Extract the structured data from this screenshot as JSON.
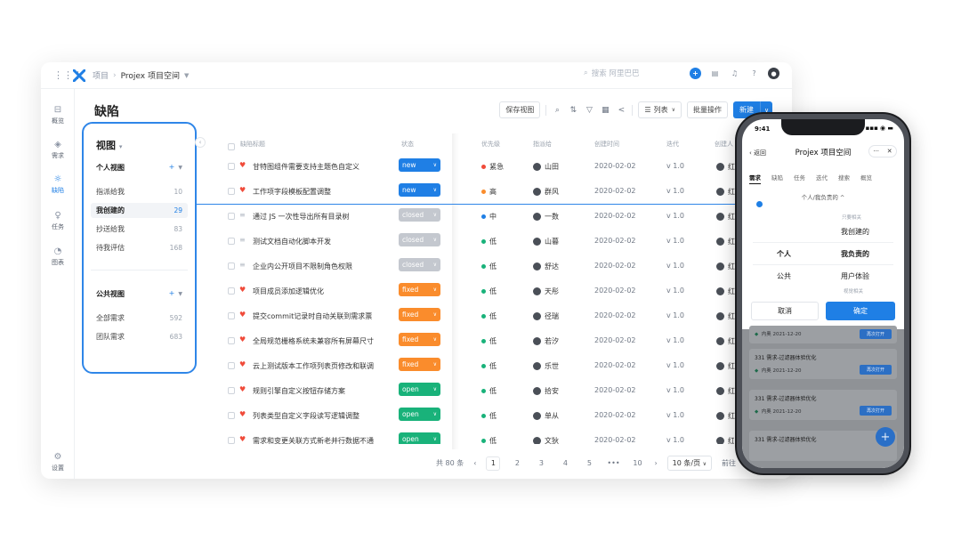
{
  "topbar": {
    "breadcrumb_root": "项目",
    "breadcrumb_sep": "›",
    "breadcrumb_current": "Projex 项目空间",
    "search_placeholder": "搜索 阿里巴巴"
  },
  "leftnav": {
    "items": [
      {
        "label": "概览",
        "icon": "overview-icon"
      },
      {
        "label": "需求",
        "icon": "layers-icon"
      },
      {
        "label": "缺陷",
        "icon": "bug-icon"
      },
      {
        "label": "任务",
        "icon": "bulb-icon"
      },
      {
        "label": "图表",
        "icon": "chart-icon"
      }
    ],
    "settings": "设置"
  },
  "page": {
    "title": "缺陷"
  },
  "toolbar": {
    "save_view": "保存视图",
    "list_view": "列表",
    "batch": "批量操作",
    "create": "新建"
  },
  "views": {
    "title": "视图",
    "personal_title": "个人视图",
    "personal": [
      {
        "label": "指派给我",
        "count": "10"
      },
      {
        "label": "我创建的",
        "count": "29"
      },
      {
        "label": "抄送给我",
        "count": "83"
      },
      {
        "label": "待我评估",
        "count": "168"
      }
    ],
    "public_title": "公共视图",
    "public": [
      {
        "label": "全部需求",
        "count": "592"
      },
      {
        "label": "团队需求",
        "count": "683"
      }
    ]
  },
  "table": {
    "headers": [
      "缺陷标题",
      "状态",
      "优先级",
      "指派给",
      "创建时间",
      "迭代",
      "创建人"
    ],
    "rows": [
      {
        "title": "甘特图组件需要支持主题色自定义",
        "type": "bug",
        "status": "new",
        "priority": "紧急",
        "prio_color": "#f04b3a",
        "assignee": "山田",
        "date": "2020-02-02",
        "iter": "v 1.0",
        "creator": "红"
      },
      {
        "title": "工作项字段模板配置调整",
        "type": "bug",
        "status": "new",
        "priority": "高",
        "prio_color": "#fa8c2c",
        "assignee": "群风",
        "date": "2020-02-02",
        "iter": "v 1.0",
        "creator": "红"
      },
      {
        "title": "通过 JS 一次性导出所有目录树",
        "type": "doc",
        "status": "closed",
        "priority": "中",
        "prio_color": "#1f7fe5",
        "assignee": "一数",
        "date": "2020-02-02",
        "iter": "v 1.0",
        "creator": "红"
      },
      {
        "title": "测试文档自动化脚本开发",
        "type": "doc",
        "status": "closed",
        "priority": "低",
        "prio_color": "#19b27a",
        "assignee": "山暮",
        "date": "2020-02-02",
        "iter": "v 1.0",
        "creator": "红"
      },
      {
        "title": "企业内公开项目不限制角色权限",
        "type": "doc",
        "status": "closed",
        "priority": "低",
        "prio_color": "#19b27a",
        "assignee": "舒达",
        "date": "2020-02-02",
        "iter": "v 1.0",
        "creator": "红"
      },
      {
        "title": "项目成员添加逻辑优化",
        "type": "bug",
        "status": "fixed",
        "priority": "低",
        "prio_color": "#19b27a",
        "assignee": "天彤",
        "date": "2020-02-02",
        "iter": "v 1.0",
        "creator": "红"
      },
      {
        "title": "提交commit记录时自动关联到需求票",
        "type": "bug",
        "status": "fixed",
        "priority": "低",
        "prio_color": "#19b27a",
        "assignee": "径瑞",
        "date": "2020-02-02",
        "iter": "v 1.0",
        "creator": "红"
      },
      {
        "title": "全局规范栅格系统未兼容所有屏幕尺寸",
        "type": "bug",
        "status": "fixed",
        "priority": "低",
        "prio_color": "#19b27a",
        "assignee": "若汐",
        "date": "2020-02-02",
        "iter": "v 1.0",
        "creator": "红"
      },
      {
        "title": "云上测试版本工作项列表页修改和联调",
        "type": "bug",
        "status": "fixed",
        "priority": "低",
        "prio_color": "#19b27a",
        "assignee": "乐世",
        "date": "2020-02-02",
        "iter": "v 1.0",
        "creator": "红"
      },
      {
        "title": "规则引擎自定义按钮存储方案",
        "type": "bug",
        "status": "open",
        "priority": "低",
        "prio_color": "#19b27a",
        "assignee": "拾安",
        "date": "2020-02-02",
        "iter": "v 1.0",
        "creator": "红"
      },
      {
        "title": "列表类型自定义字段读写逻辑调整",
        "type": "bug",
        "status": "open",
        "priority": "低",
        "prio_color": "#19b27a",
        "assignee": "单从",
        "date": "2020-02-02",
        "iter": "v 1.0",
        "creator": "红"
      },
      {
        "title": "需求和变更关联方式新老并行数据不通",
        "type": "bug",
        "status": "open",
        "priority": "低",
        "prio_color": "#19b27a",
        "assignee": "文狄",
        "date": "2020-02-02",
        "iter": "v 1.0",
        "creator": "红"
      }
    ]
  },
  "pager": {
    "total": "共 80 条",
    "pages": [
      "1",
      "2",
      "3",
      "4",
      "5",
      "•••",
      "10"
    ],
    "size": "10 条/页",
    "goto": "前往"
  },
  "phone": {
    "time": "9:41",
    "status": "▪▪▪ ◉ ▬",
    "back": "‹ 返回",
    "title": "Projex 项目空间",
    "tabs": [
      "需求",
      "缺陷",
      "任务",
      "迭代",
      "搜索",
      "概览"
    ],
    "filter": "个人/我负责的 ^",
    "opt_group1": "只要相关",
    "opt_created": "我创建的",
    "opt_personal": "个人",
    "opt_mine": "我负责的",
    "opt_public": "公共",
    "opt_ux": "用户体验",
    "opt_group2": "视觉相关",
    "cancel": "取消",
    "confirm": "确定",
    "cards": [
      {
        "title": "",
        "meta": "内奥  2021-12-20",
        "btn": "再次打开"
      },
      {
        "title": "331 需求-过滤器体验优化",
        "meta": "内奥  2021-12-20",
        "btn": "再次打开"
      },
      {
        "title": "331 需求-过滤器体验优化",
        "meta": "内奥  2021-12-20",
        "btn": "再次打开"
      },
      {
        "title": "331 需求-过滤器体验优化",
        "meta": "",
        "btn": ""
      }
    ]
  },
  "colors": {
    "accent": "#1f7fe5",
    "new": "#1f7fe5",
    "closed": "#c4c8cf",
    "fixed": "#fa8c2c",
    "open": "#19b27a",
    "bug": "#f04b3a"
  }
}
